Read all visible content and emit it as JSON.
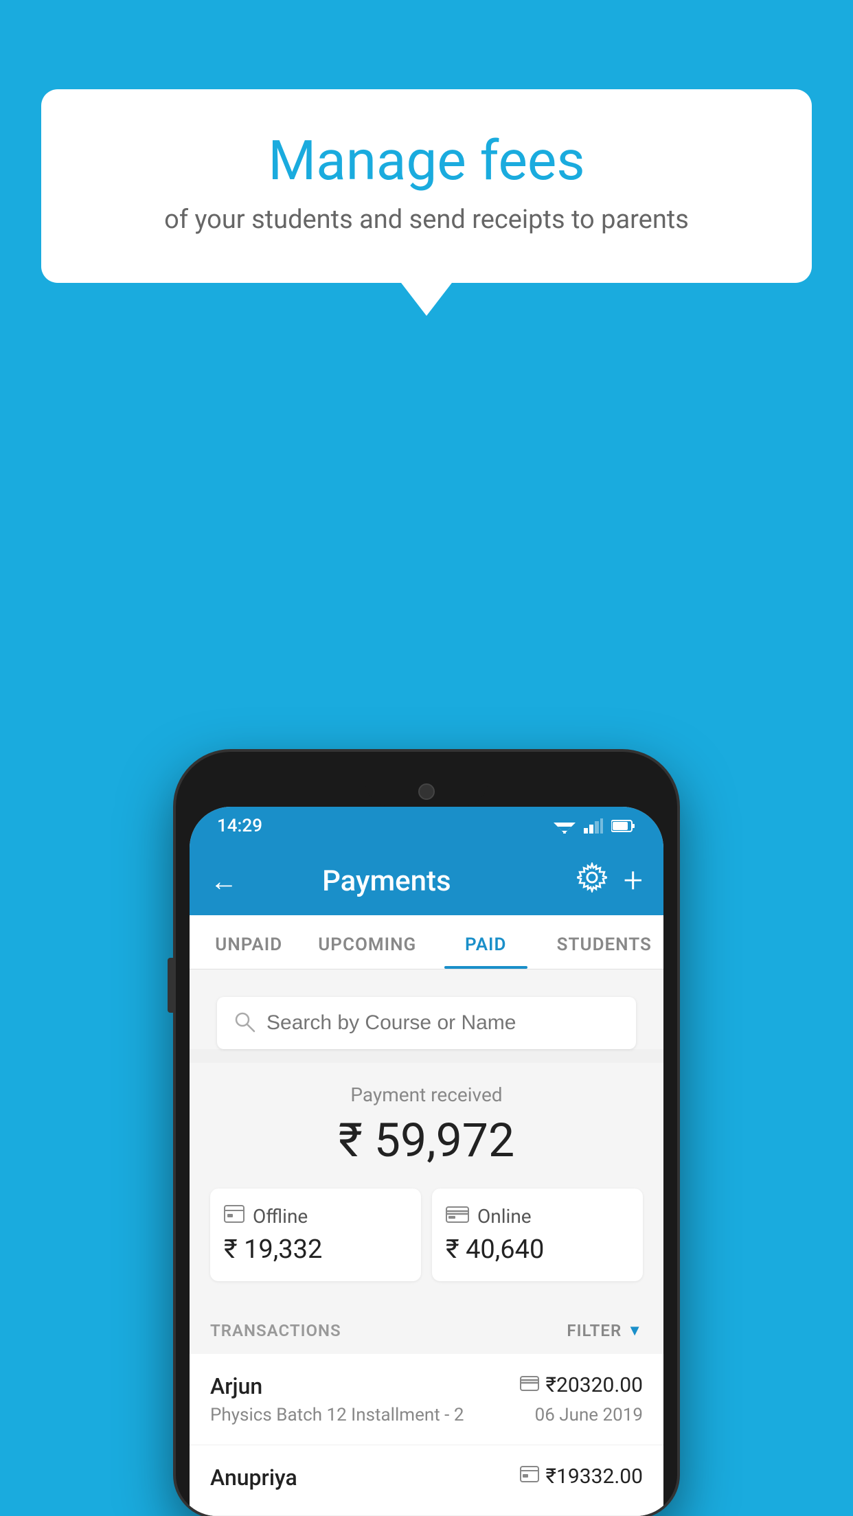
{
  "background_color": "#1AABDE",
  "tooltip": {
    "title": "Manage fees",
    "subtitle": "of your students and send receipts to parents"
  },
  "status_bar": {
    "time": "14:29"
  },
  "header": {
    "title": "Payments",
    "back_label": "←",
    "plus_label": "+"
  },
  "tabs": [
    {
      "label": "UNPAID",
      "active": false
    },
    {
      "label": "UPCOMING",
      "active": false
    },
    {
      "label": "PAID",
      "active": true
    },
    {
      "label": "STUDENTS",
      "active": false
    }
  ],
  "search": {
    "placeholder": "Search by Course or Name"
  },
  "payment_summary": {
    "label": "Payment received",
    "total": "₹ 59,972",
    "offline_label": "Offline",
    "offline_amount": "₹ 19,332",
    "online_label": "Online",
    "online_amount": "₹ 40,640"
  },
  "transactions": {
    "section_label": "TRANSACTIONS",
    "filter_label": "FILTER",
    "items": [
      {
        "name": "Arjun",
        "course": "Physics Batch 12 Installment - 2",
        "amount": "₹20320.00",
        "date": "06 June 2019",
        "payment_type": "card"
      },
      {
        "name": "Anupriya",
        "course": "",
        "amount": "₹19332.00",
        "date": "",
        "payment_type": "offline"
      }
    ]
  },
  "icons": {
    "back": "←",
    "gear": "⚙",
    "plus": "+",
    "search": "🔍",
    "filter_triangle": "▼",
    "card": "💳",
    "offline": "🪙"
  }
}
